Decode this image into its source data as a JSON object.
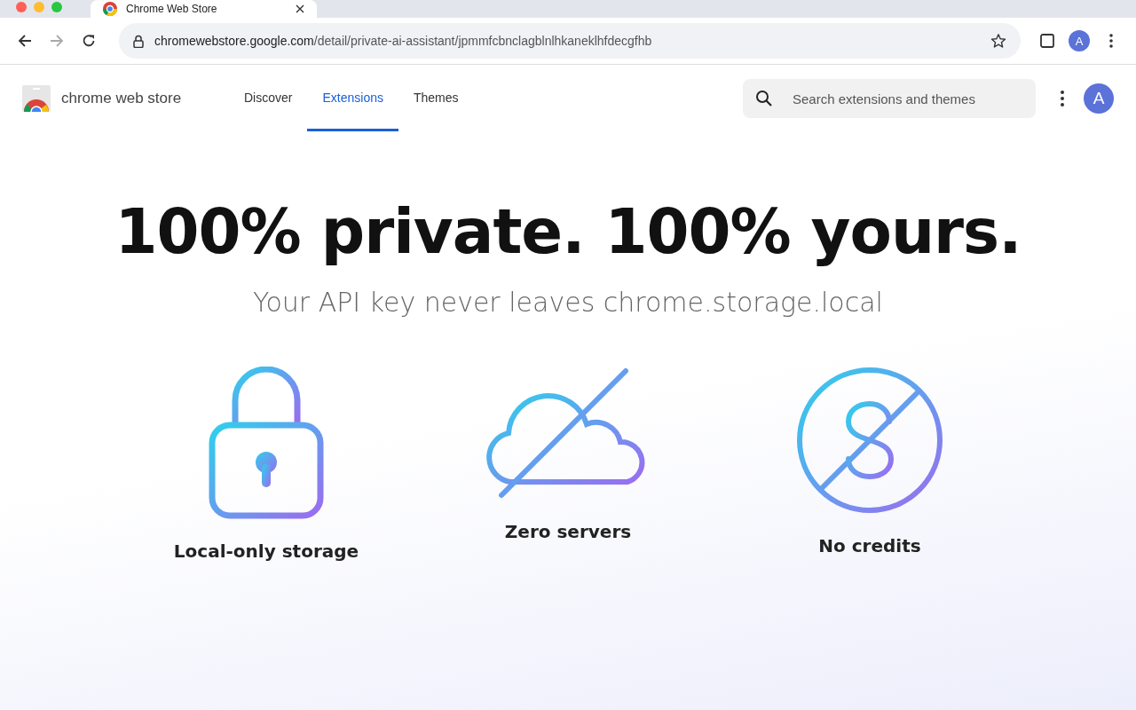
{
  "browser": {
    "tab_title": "Chrome Web Store",
    "url": "chromewebstore.google.com/detail/private-ai-assistant/jpmmfcbnclagblnlhkaneklhfdecgfhb",
    "profile_initial": "A"
  },
  "store": {
    "brand": "chrome web store",
    "nav": [
      {
        "label": "Discover",
        "selected": false
      },
      {
        "label": "Extensions",
        "selected": true
      },
      {
        "label": "Themes",
        "selected": false
      }
    ],
    "search": {
      "placeholder": "Search extensions and themes"
    },
    "avatar_initial": "A"
  },
  "hero": {
    "headline": "100% private. 100% yours.",
    "subtitle": "Your API key never leaves chrome.storage.local",
    "features": [
      {
        "kind": "lock",
        "label": "Local-only storage"
      },
      {
        "kind": "cloud-off",
        "label": "Zero servers"
      },
      {
        "kind": "no-dollar",
        "label": "No credits"
      }
    ]
  }
}
